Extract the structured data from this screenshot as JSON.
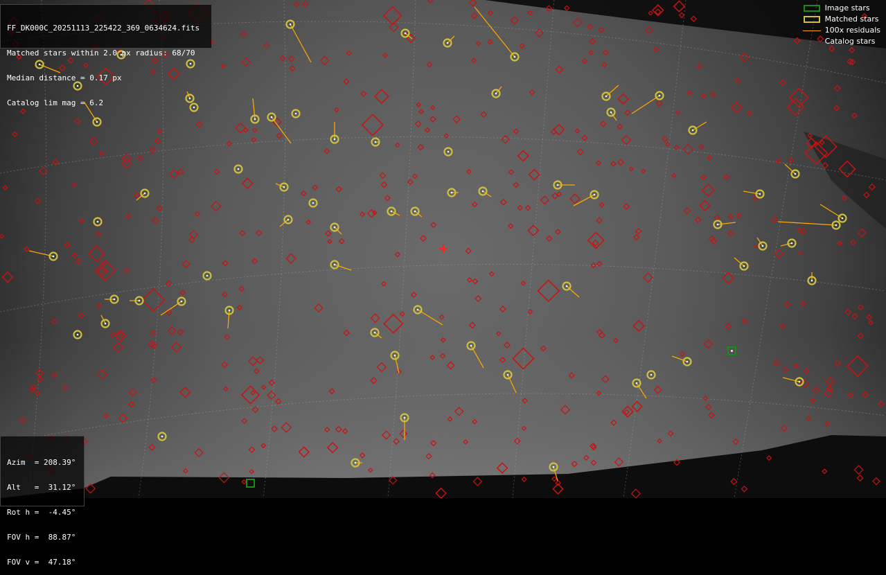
{
  "header": {
    "lines": [
      "FF_DK000C_20251113_225422_369_0634624.fits",
      "Matched stars within 2.0 px radius: 68/70",
      "Median distance = 0.17 px",
      "Catalog lim mag = 6.2"
    ]
  },
  "pointing": {
    "lines": [
      "Azim  = 208.39°",
      "Alt   =  31.12°",
      "Rot h =  -4.45°",
      "FOV h =  88.87°",
      "FOV v =  47.18°"
    ]
  },
  "legend": {
    "image_stars": "Image stars",
    "matched_stars": "Matched stars",
    "residuals": "100x residuals",
    "catalog_stars": "Catalog stars"
  },
  "colors": {
    "image_star": "#1a8c1a",
    "matched_star": "#d0c040",
    "residual": "#ffa500",
    "catalog_star": "#cc1111",
    "center_marker": "#ff2020"
  }
}
